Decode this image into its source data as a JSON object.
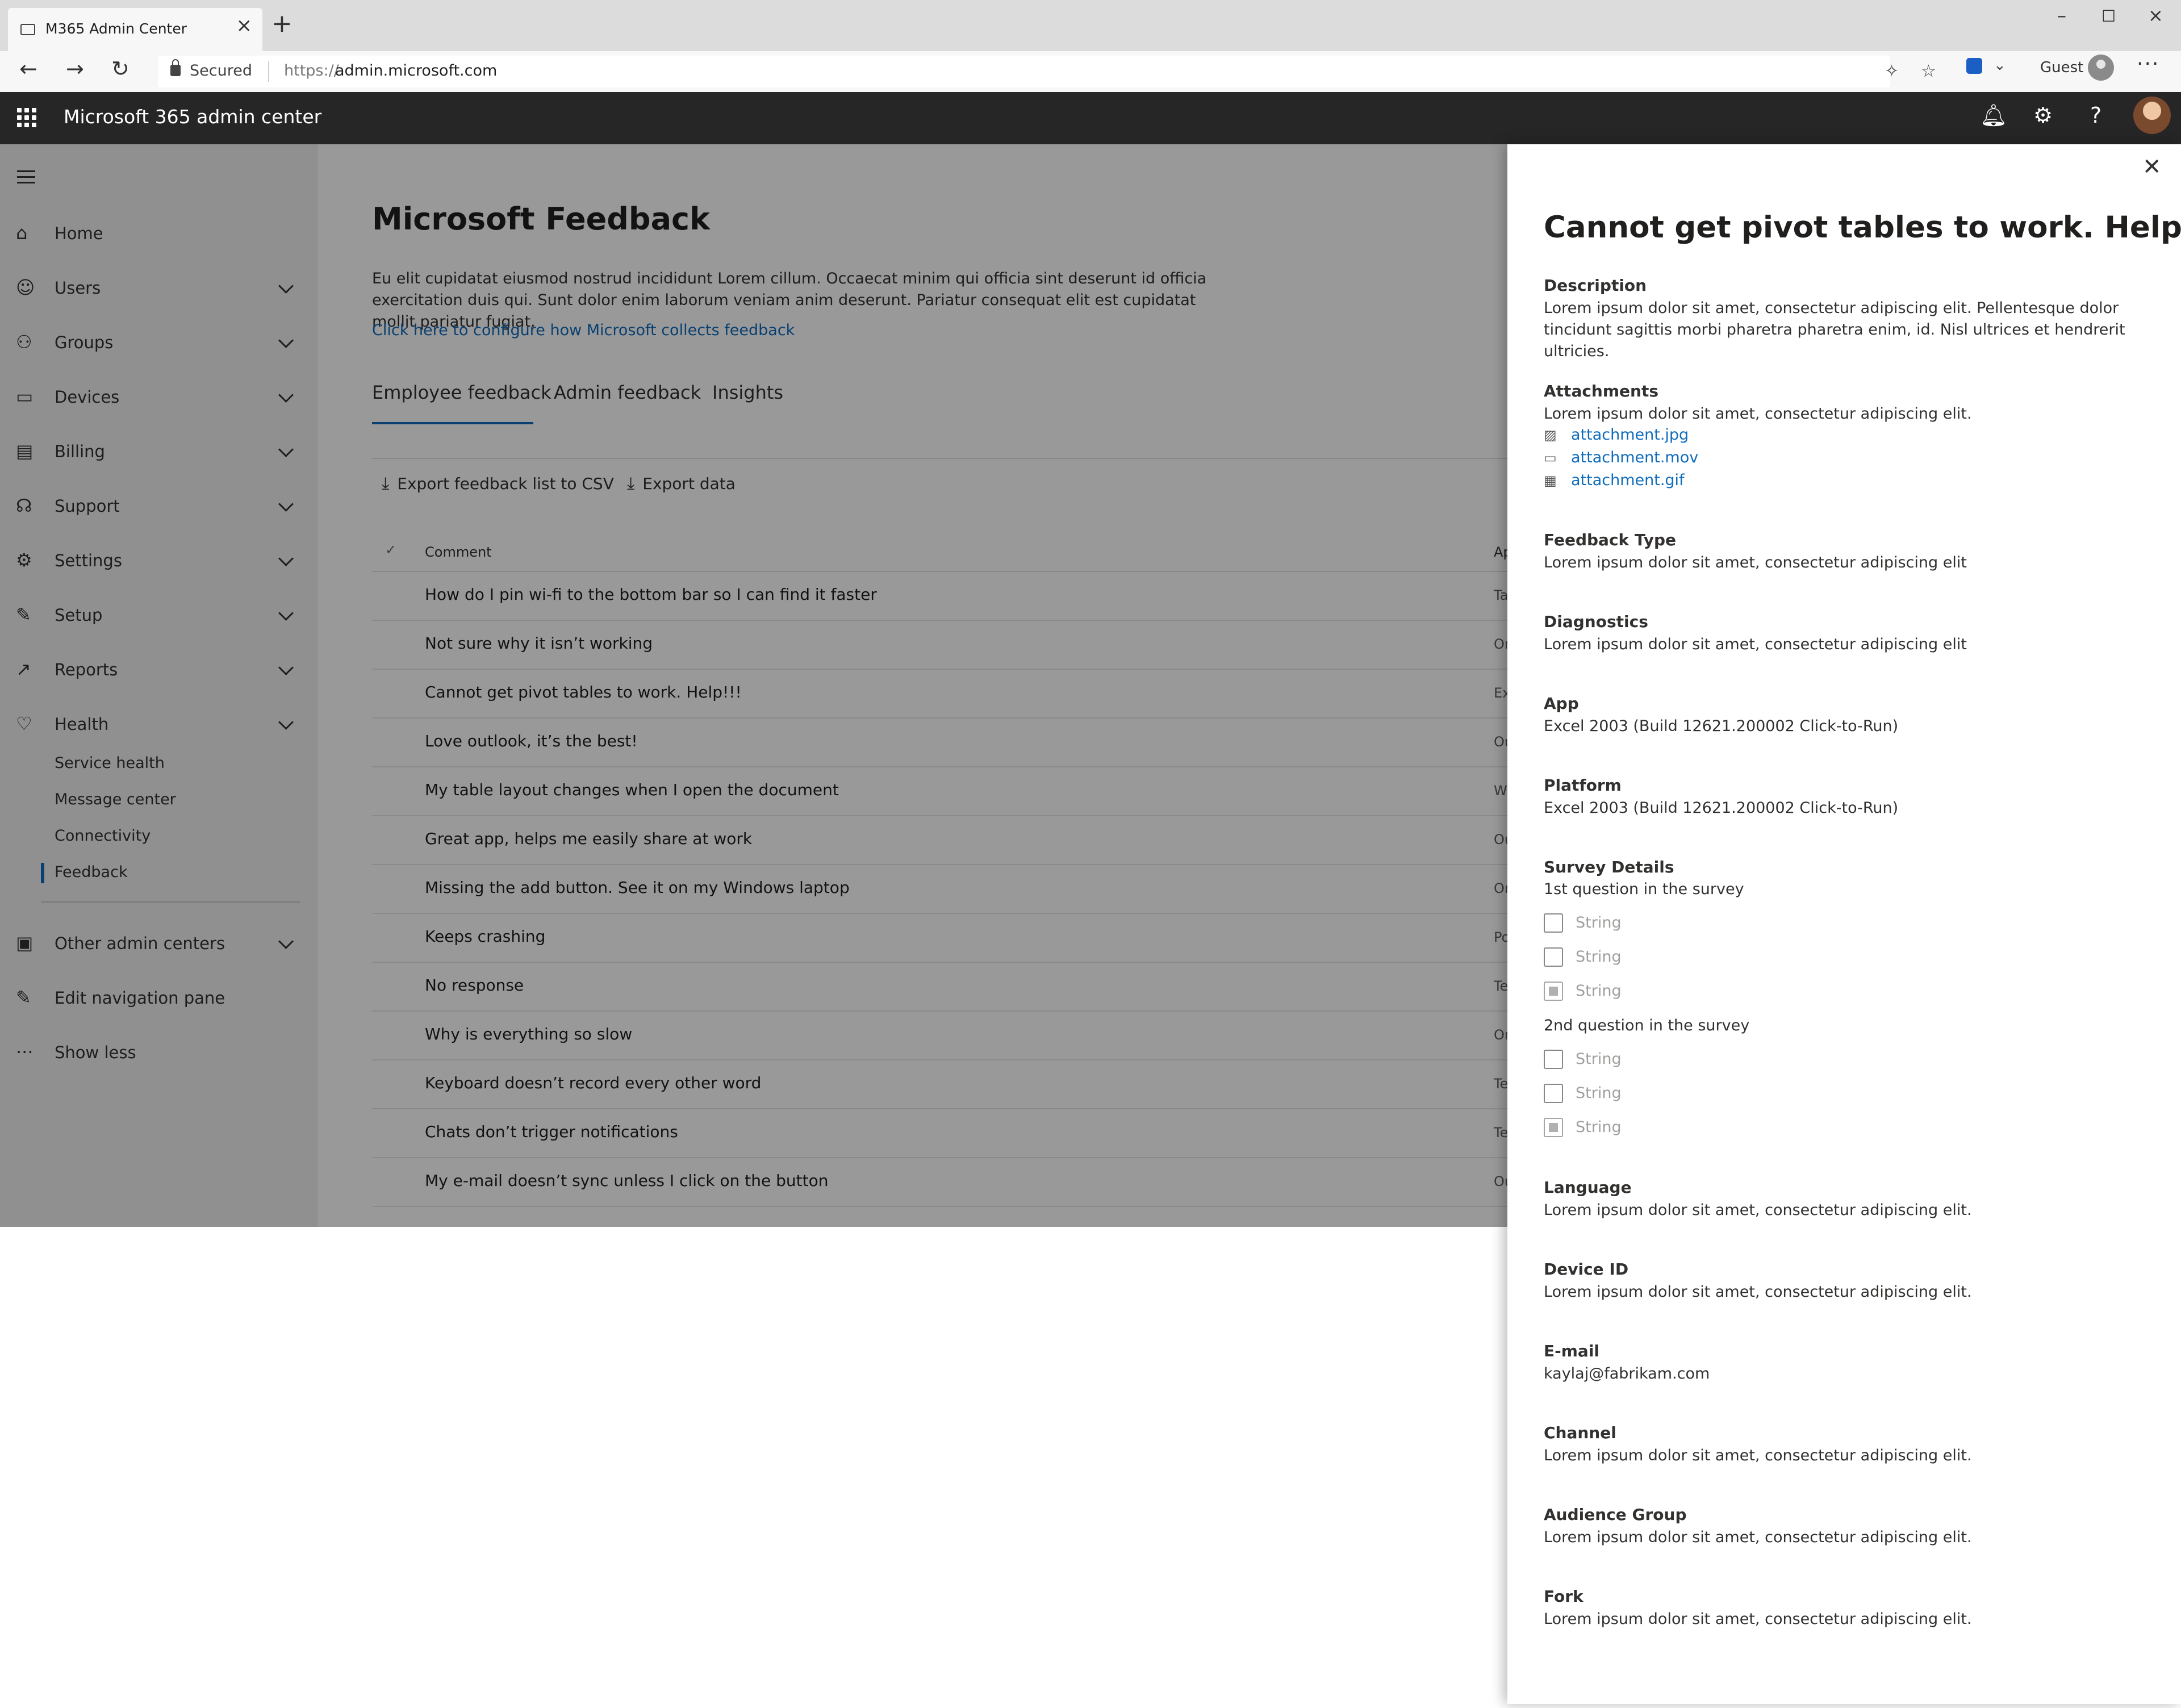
{
  "browser": {
    "tab_title": "M365 Admin Center",
    "secured_label": "Secured",
    "url_protocol": "https://",
    "url_host": "admin.microsoft.com",
    "profile_label": "Guest"
  },
  "suite": {
    "title": "Microsoft 365 admin center"
  },
  "nav": {
    "items": [
      {
        "label": "Home",
        "icon": "home-icon"
      },
      {
        "label": "Users",
        "icon": "user-icon"
      },
      {
        "label": "Groups",
        "icon": "groups-icon"
      },
      {
        "label": "Devices",
        "icon": "devices-icon"
      },
      {
        "label": "Billing",
        "icon": "billing-icon"
      },
      {
        "label": "Support",
        "icon": "support-icon"
      },
      {
        "label": "Settings",
        "icon": "settings-icon"
      },
      {
        "label": "Setup",
        "icon": "wrench-icon"
      },
      {
        "label": "Reports",
        "icon": "chart-icon"
      },
      {
        "label": "Health",
        "icon": "heart-icon"
      }
    ],
    "health_sub": [
      "Service health",
      "Message center",
      "Connectivity",
      "Feedback"
    ],
    "other_admin": "Other admin centers",
    "edit_nav": "Edit navigation pane",
    "show_less": "Show less"
  },
  "page": {
    "title": "Microsoft Feedback",
    "description": "Eu elit cupidatat eiusmod nostrud incididunt Lorem cillum. Occaecat minim qui officia sint deserunt id officia exercitation duis qui. Sunt dolor enim laborum veniam anim deserunt. Pariatur consequat elit est cupidatat mollit pariatur fugiat.",
    "config_link": "Click here to configure how Microsoft collects feedback",
    "tabs": [
      "Employee feedback",
      "Admin feedback",
      "Insights"
    ],
    "commands": {
      "export_csv": "Export feedback list to CSV",
      "export_data": "Export data"
    },
    "columns": {
      "comment": "Comment",
      "app": "Ap"
    },
    "rows": [
      {
        "comment": "How do I pin wi-fi to the bottom bar so I can find it faster",
        "app": "Ta"
      },
      {
        "comment": "Not sure why it isn’t working",
        "app": "Or"
      },
      {
        "comment": "Cannot get pivot tables to work. Help!!!",
        "app": "Ex"
      },
      {
        "comment": "Love outlook, it’s the best!",
        "app": "Ou"
      },
      {
        "comment": "My table layout changes when I open the document",
        "app": "W"
      },
      {
        "comment": "Great app, helps me easily share at work",
        "app": "Ou"
      },
      {
        "comment": "Missing the add button. See it on my Windows laptop",
        "app": "Or"
      },
      {
        "comment": "Keeps crashing",
        "app": "Po"
      },
      {
        "comment": "No response",
        "app": "Te"
      },
      {
        "comment": "Why is everything so slow",
        "app": "Or"
      },
      {
        "comment": "Keyboard doesn’t record every other word",
        "app": "Te"
      },
      {
        "comment": "Chats don’t trigger notifications",
        "app": "Te"
      },
      {
        "comment": "My e-mail doesn’t sync unless I click on the button",
        "app": "Ou"
      }
    ]
  },
  "panel": {
    "title": "Cannot get pivot tables to work. Help!!!",
    "description_label": "Description",
    "description_value": "Lorem ipsum dolor sit amet, consectetur adipiscing elit. Pellentesque dolor tincidunt sagittis morbi pharetra pharetra enim, id. Nisl ultrices et hendrerit ultricies.",
    "attachments_label": "Attachments",
    "attachments_value": "Lorem ipsum dolor sit amet, consectetur adipiscing elit.",
    "attachments": [
      "attachment.jpg",
      "attachment.mov",
      "attachment.gif"
    ],
    "feedback_type_label": "Feedback Type",
    "feedback_type_value": "Lorem ipsum dolor sit amet, consectetur adipiscing elit",
    "diagnostics_label": "Diagnostics",
    "diagnostics_value": "Lorem ipsum dolor sit amet, consectetur adipiscing elit",
    "app_label": "App",
    "app_value": "Excel 2003 (Build 12621.200002 Click-to-Run)",
    "platform_label": "Platform",
    "platform_value": "Excel 2003 (Build 12621.200002 Click-to-Run)",
    "survey_label": "Survey Details",
    "q1": "1st question in the survey",
    "q2": "2nd question in the survey",
    "option": "String",
    "language_label": "Language",
    "language_value": "Lorem ipsum dolor sit amet, consectetur adipiscing elit.",
    "device_label": "Device ID",
    "device_value": "Lorem ipsum dolor sit amet, consectetur adipiscing elit.",
    "email_label": "E-mail",
    "email_value": "kaylaj@fabrikam.com",
    "channel_label": "Channel",
    "channel_value": "Lorem ipsum dolor sit amet, consectetur adipiscing elit.",
    "audience_label": "Audience Group",
    "audience_value": "Lorem ipsum dolor sit amet, consectetur adipiscing elit.",
    "fork_label": "Fork",
    "fork_value": "Lorem ipsum dolor sit amet, consectetur adipiscing elit."
  }
}
